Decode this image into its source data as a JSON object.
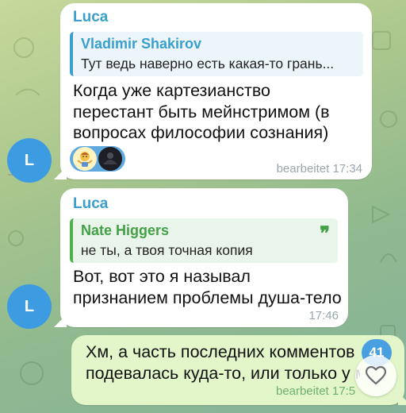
{
  "chat": {
    "messages": [
      {
        "avatar_letter": "L",
        "sender": "Luca",
        "reply": {
          "name": "Vladimir Shakirov",
          "text": "Тут ведь наверно есть какая-то грань..."
        },
        "lines": [
          "Когда уже картезианство",
          "перестант быть мейнстримом (в",
          "вопросах философии сознания)"
        ],
        "reactions": [
          "person-shrugging-emoji",
          "dark-avatar"
        ],
        "meta": "bearbeitet 17:34"
      },
      {
        "avatar_letter": "L",
        "sender": "Luca",
        "reply": {
          "name": "Nate Higgers",
          "text": "не ты, а твоя точная копия",
          "quote_icon": "❞"
        },
        "lines": [
          "Вот, вот это я называл",
          "признанием проблемы душа-тело"
        ],
        "meta": "17:46"
      },
      {
        "outgoing": true,
        "lines": [
          "Хм, а часть последних комментов",
          "подевалась куда-то, или только у м"
        ],
        "meta": "bearbeitet 17:5"
      }
    ]
  },
  "overlay": {
    "unread_badge": "41",
    "heart_icon": "heart-icon"
  },
  "colors": {
    "accent": "#3a9fcc",
    "reply_green": "#43a047",
    "avatar_bg": "#3d9be2",
    "outgoing_bg": "#e2f6c9"
  }
}
